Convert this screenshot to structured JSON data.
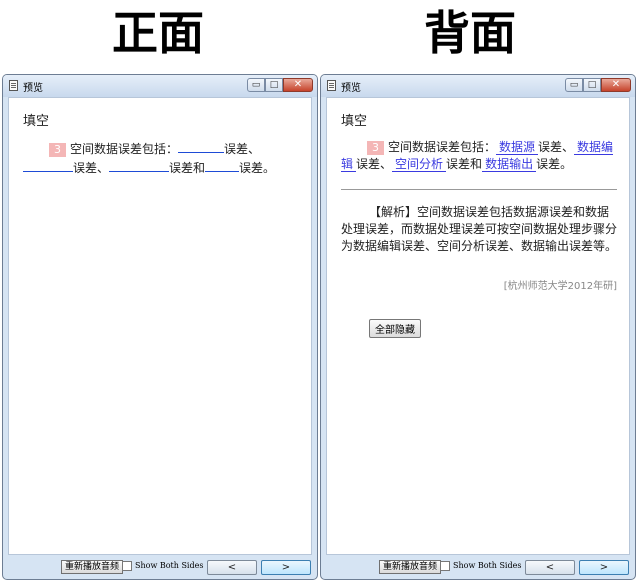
{
  "headings": {
    "front": "正面",
    "back": "背面"
  },
  "window": {
    "title": "预览",
    "controls": {
      "minimize": "▭",
      "maximize": "□",
      "close": "✕"
    }
  },
  "card": {
    "type_label": "填空",
    "number": "3",
    "q_part1": "空间数据误差包括：",
    "q_part2": "误差、",
    "q_part3": "误差、",
    "q_part4": "误差和",
    "q_part5": "误差。",
    "answers": [
      "数据源",
      "数据编辑",
      "空间分析",
      "数据输出"
    ],
    "analysis": "【解析】空间数据误差包括数据源误差和数据处理误差，而数据处理误差可按空间数据处理步骤分为数据编辑误差、空间分析误差、数据输出误差等。",
    "source": "[杭州师范大学2012年研]",
    "hide_all": "全部隐藏"
  },
  "bottom": {
    "replay_audio": "重新播放音频",
    "show_both_sides": "Show Both Sides",
    "prev": "<",
    "next": ">"
  }
}
